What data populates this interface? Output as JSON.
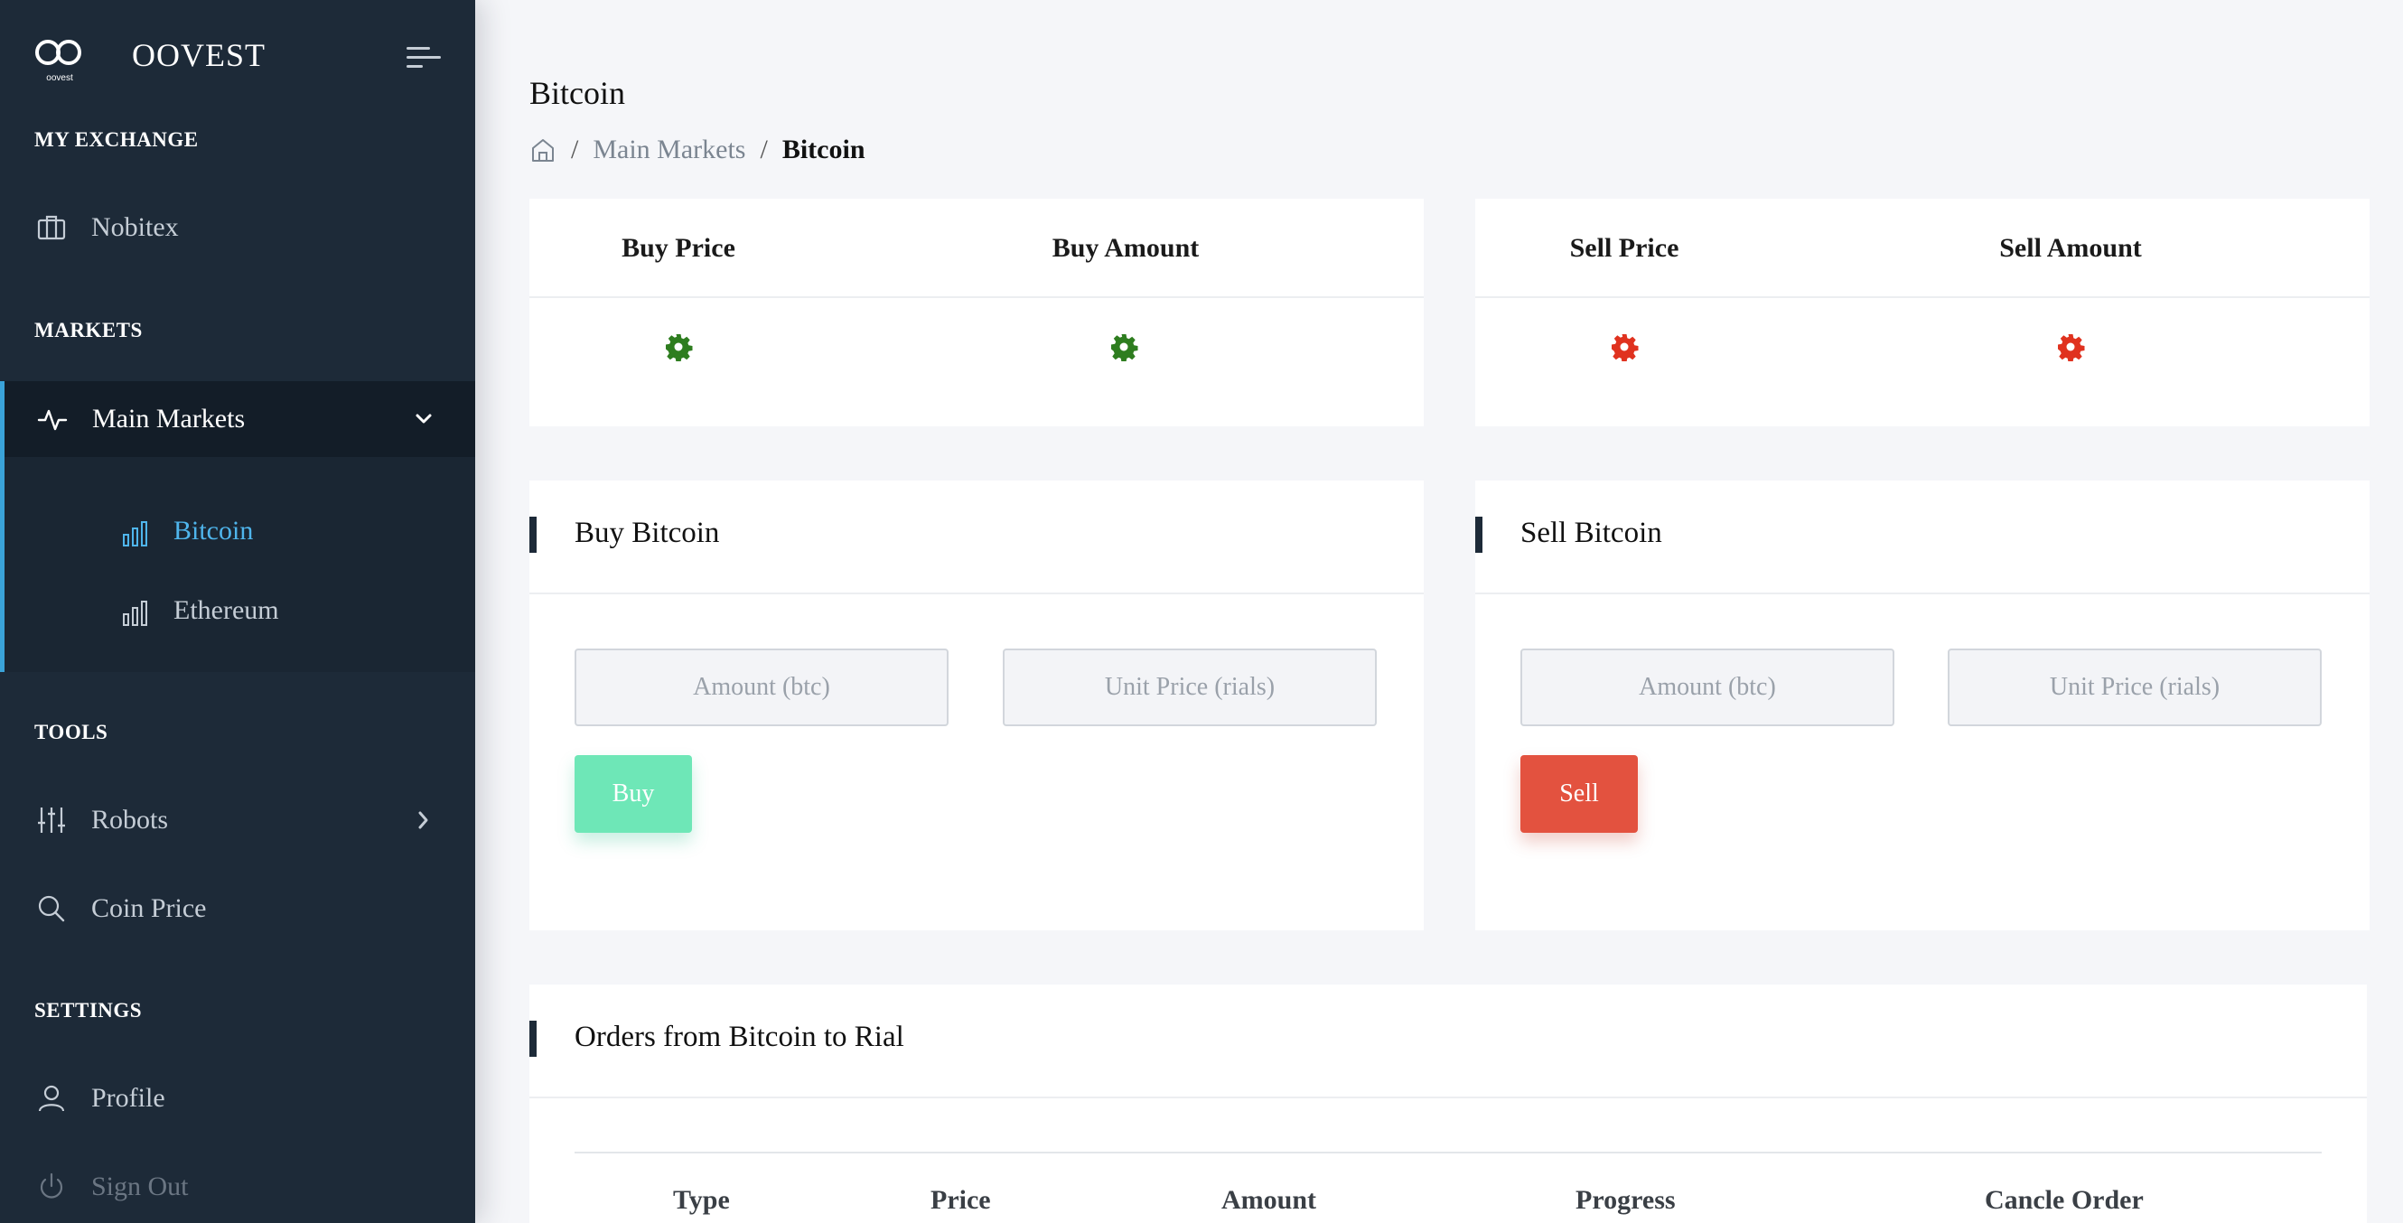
{
  "brand": {
    "logo_text": "oovest",
    "name": "OOVEST"
  },
  "sidebar": {
    "sections": {
      "my_exchange": "MY EXCHANGE",
      "markets": "MARKETS",
      "tools": "TOOLS",
      "settings": "SETTINGS"
    },
    "items": {
      "nobitex": {
        "label": "Nobitex",
        "icon": "briefcase-icon"
      },
      "main_markets": {
        "label": "Main Markets",
        "icon": "activity-icon",
        "expanded": true
      },
      "bitcoin": {
        "label": "Bitcoin",
        "icon": "bar-chart-icon",
        "active": true
      },
      "ethereum": {
        "label": "Ethereum",
        "icon": "bar-chart-icon"
      },
      "robots": {
        "label": "Robots",
        "icon": "sliders-icon"
      },
      "coin_price": {
        "label": "Coin Price",
        "icon": "search-icon"
      },
      "profile": {
        "label": "Profile",
        "icon": "user-icon"
      },
      "sign_out": {
        "label": "Sign Out",
        "icon": "power-icon"
      }
    }
  },
  "page": {
    "title": "Bitcoin",
    "breadcrumb": {
      "parent": "Main Markets",
      "separator": "/",
      "current": "Bitcoin"
    }
  },
  "price_cards": {
    "buy": {
      "price_header": "Buy Price",
      "amount_header": "Buy Amount",
      "loading_color": "#2e7d1f"
    },
    "sell": {
      "price_header": "Sell Price",
      "amount_header": "Sell Amount",
      "loading_color": "#e0321f"
    }
  },
  "buy_form": {
    "title": "Buy Bitcoin",
    "amount_placeholder": "Amount (btc)",
    "price_placeholder": "Unit Price (rials)",
    "button_label": "Buy",
    "button_color": "#6ee7b7"
  },
  "sell_form": {
    "title": "Sell Bitcoin",
    "amount_placeholder": "Amount (btc)",
    "price_placeholder": "Unit Price (rials)",
    "button_label": "Sell",
    "button_color": "#e3523f"
  },
  "orders": {
    "title": "Orders from Bitcoin to Rial",
    "columns": [
      "Type",
      "Price",
      "Amount",
      "Progress",
      "Cancle Order"
    ]
  }
}
